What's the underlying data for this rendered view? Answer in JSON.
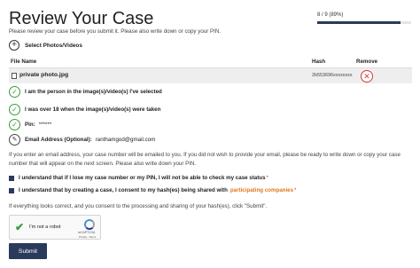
{
  "page": {
    "title": "Review Your Case",
    "subtitle": "Please review your case before you submit it. Please also write down or copy your PIN."
  },
  "progress": {
    "label": "8 / 9 (89%)",
    "fraction": 0.89,
    "fill_color": "#2a3a5a"
  },
  "select_photos": {
    "label": "Select Photos/Videos",
    "icon": "plus-circle-icon"
  },
  "file_table": {
    "headers": {
      "file_name": "File Name",
      "hash": "Hash",
      "remove": "Remove"
    },
    "rows": [
      {
        "file_name": "private photo.jpg",
        "hash": "2b553696xxxxxxxx",
        "remove_icon": "x-circle-icon"
      }
    ]
  },
  "checklist": [
    {
      "text": "I am the person in the image(s)/video(s) I've selected",
      "icon": "check-circle-icon"
    },
    {
      "text": "I was over 18 when the image(s)/video(s) were taken",
      "icon": "check-circle-icon"
    },
    {
      "text": "Pin:",
      "value": "******",
      "icon": "check-circle-icon"
    },
    {
      "text": "Email Address (Optional):",
      "value": "ranthamgod@gmail.com",
      "icon": "pencil-icon"
    }
  ],
  "info_text": "If you enter an email address, your case number will be emailed to you. If you did not wish to provide your email, please be ready to write down or copy your case number that will appear on the next screen. Please also write down your PIN.",
  "consents": [
    {
      "text": "I understand that if I lose my case number or my PIN, I will not be able to check my case status",
      "required_mark": "*"
    },
    {
      "text": "I understand that by creating a case, I consent to my hash(es) being shared with",
      "link_text": "participating companies",
      "required_mark": "*"
    }
  ],
  "final_text": "If everything looks correct, and you consent to the processing and sharing of your hash(es), click \"Submit\".",
  "captcha": {
    "label": "I'm not a robot",
    "brand": "reCAPTCHA",
    "terms": "Privacy - Terms"
  },
  "submit": {
    "label": "Submit"
  },
  "colors": {
    "primary": "#2a3a5a",
    "success": "#3a9c3a",
    "danger": "#d43a3a",
    "link": "#e0771a"
  }
}
